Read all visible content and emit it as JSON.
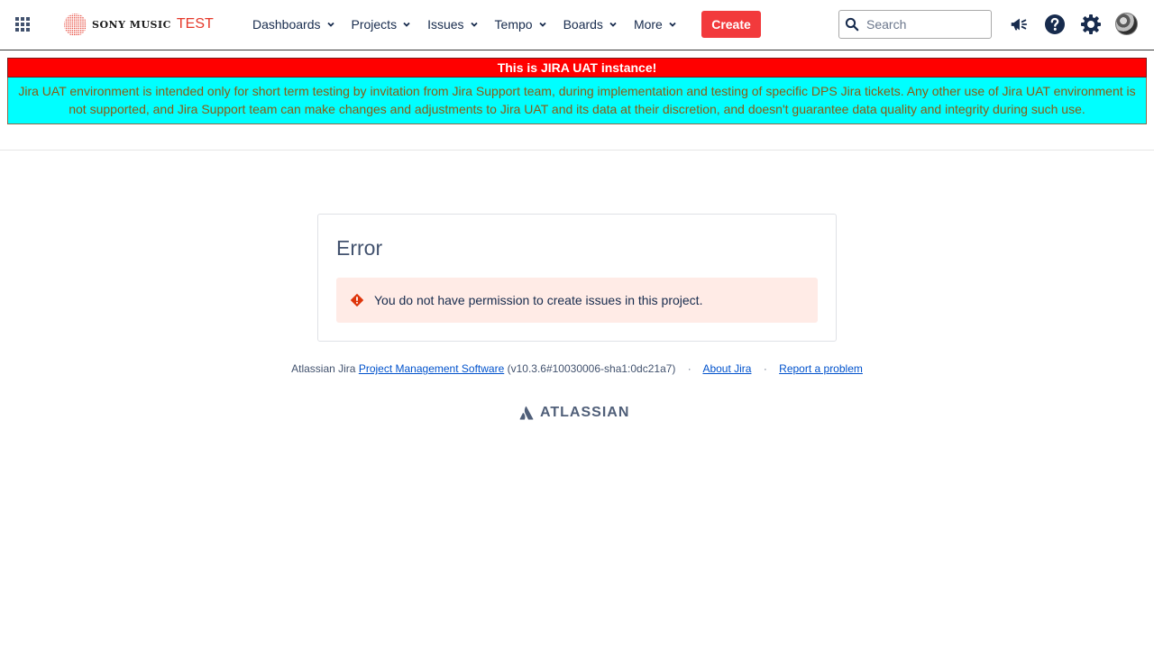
{
  "header": {
    "brand": "SONY MUSIC",
    "environment": "TEST",
    "nav": [
      {
        "label": "Dashboards"
      },
      {
        "label": "Projects"
      },
      {
        "label": "Issues"
      },
      {
        "label": "Tempo"
      },
      {
        "label": "Boards"
      },
      {
        "label": "More"
      }
    ],
    "create_label": "Create",
    "search_placeholder": "Search",
    "icons": [
      "app-switcher-icon",
      "megaphone-icon",
      "help-icon",
      "gear-icon",
      "avatar"
    ]
  },
  "banner": {
    "title": "This is JIRA UAT instance!",
    "body": "Jira UAT environment is intended only for short term testing by invitation from Jira Support team, during implementation and testing of specific DPS Jira tickets. Any other use of Jira UAT environment is not supported, and Jira Support team can make changes and adjustments to Jira UAT and its data at their discretion, and doesn't guarantee data quality and integrity during such use."
  },
  "error": {
    "title": "Error",
    "message": "You do not have permission to create issues in this project."
  },
  "footer": {
    "prefix": "Atlassian Jira",
    "pm_link": "Project Management Software",
    "version": "(v10.3.6#10030006-sha1:0dc21a7)",
    "about_link": "About Jira",
    "report_link": "Report a problem",
    "separator": "·",
    "atlassian_logo": "ATLASSIAN"
  },
  "colors": {
    "create_button": "#f23a3c",
    "banner_title_bg": "#ff0000",
    "banner_body_bg": "#00ffff",
    "banner_body_text": "#8b5a12",
    "error_bg": "#ffebe6",
    "error_icon": "#de350b",
    "link": "#0052cc"
  }
}
